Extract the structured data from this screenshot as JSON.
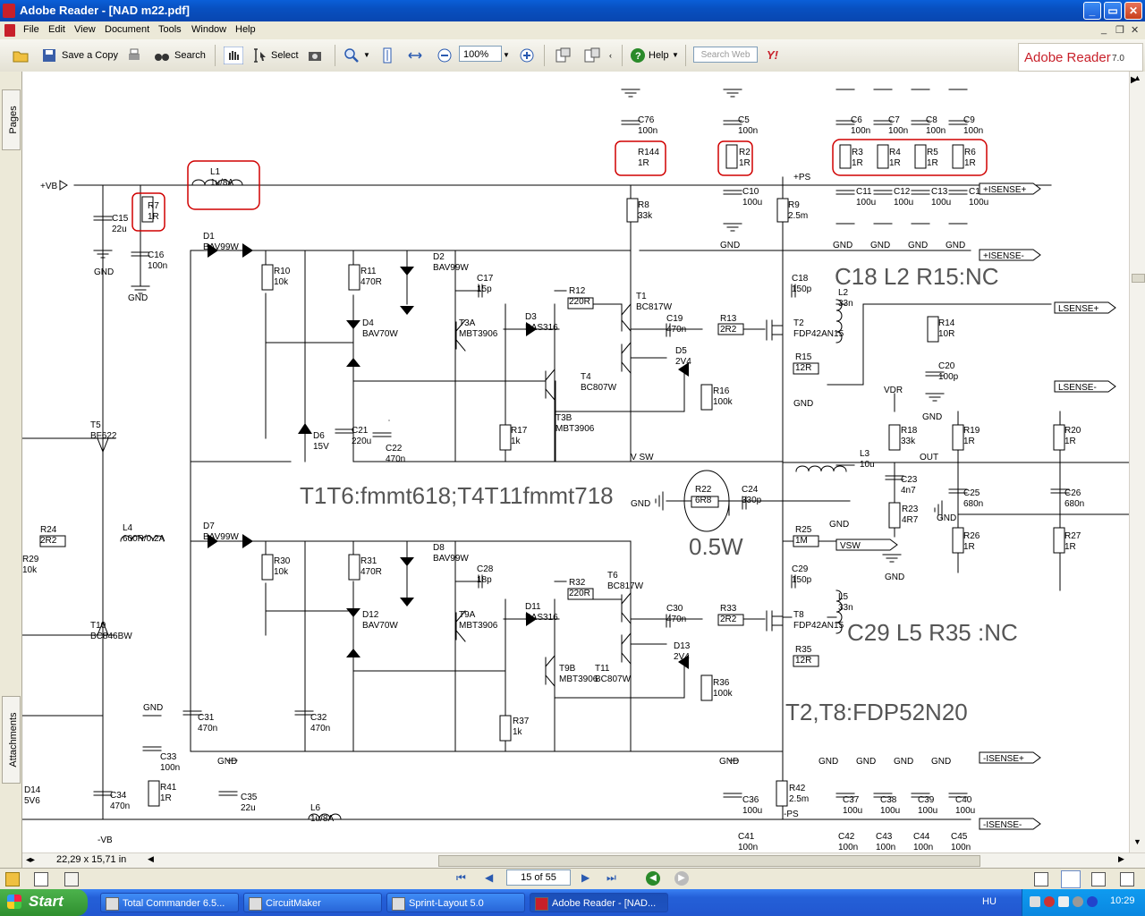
{
  "window": {
    "title": "Adobe Reader - [NAD m22.pdf]",
    "buttons": {
      "minimize": "_",
      "maximize": "▭",
      "close": "✕"
    }
  },
  "menu": [
    "File",
    "Edit",
    "View",
    "Document",
    "Tools",
    "Window",
    "Help"
  ],
  "toolbar": {
    "save_copy": "Save a Copy",
    "search": "Search",
    "select": "Select",
    "zoom": "100%",
    "help": "Help",
    "search_web_placeholder": "Search Web",
    "brand": "Adobe Reader",
    "version": "7.0"
  },
  "left_tabs": {
    "pages": "Pages",
    "attachments": "Attachments"
  },
  "status": {
    "page_size": "22,29 x 15,71 in",
    "page_box": "15 of 55"
  },
  "taskbar": {
    "start": "Start",
    "tasks": [
      "Total Commander 6.5...",
      "CircuitMaker",
      "Sprint-Layout 5.0",
      "Adobe Reader - [NAD..."
    ],
    "lang": "HU",
    "clock": "10:29"
  },
  "schematic": {
    "notes": [
      "C18 L2 R15:NC",
      "T1T6:fmmt618;T4T11fmmt718",
      "0.5W",
      "C29 L5 R35 :NC",
      "T2,T8:FDP52N20"
    ],
    "ports": [
      "+ISENSE+",
      "+ISENSE-",
      "LSENSE+",
      "LSENSE-",
      "VSW",
      "-ISENSE+",
      "-ISENSE-"
    ],
    "rails": [
      "+VB",
      "-VB",
      "+PS",
      "-PS",
      "VDR",
      "OUT",
      "V SW"
    ],
    "components": [
      {
        "ref": "L1",
        "val": "1u/8A"
      },
      {
        "ref": "R7",
        "val": "1R"
      },
      {
        "ref": "C15",
        "val": "22u"
      },
      {
        "ref": "C16",
        "val": "100n"
      },
      {
        "ref": "R144",
        "val": "1R"
      },
      {
        "ref": "C76",
        "val": "100n"
      },
      {
        "ref": "R2",
        "val": "1R"
      },
      {
        "ref": "C5",
        "val": "100n"
      },
      {
        "ref": "R3",
        "val": "1R"
      },
      {
        "ref": "R4",
        "val": "1R"
      },
      {
        "ref": "R5",
        "val": "1R"
      },
      {
        "ref": "R6",
        "val": "1R"
      },
      {
        "ref": "C6",
        "val": "100n"
      },
      {
        "ref": "C7",
        "val": "100n"
      },
      {
        "ref": "C8",
        "val": "100n"
      },
      {
        "ref": "C9",
        "val": "100n"
      },
      {
        "ref": "C10",
        "val": "100u"
      },
      {
        "ref": "C11",
        "val": "100u"
      },
      {
        "ref": "C12",
        "val": "100u"
      },
      {
        "ref": "C13",
        "val": "100u"
      },
      {
        "ref": "C14",
        "val": "100u"
      },
      {
        "ref": "R8",
        "val": "33k"
      },
      {
        "ref": "R9",
        "val": "2.5m"
      },
      {
        "ref": "D1",
        "val": "BAV99W"
      },
      {
        "ref": "D2",
        "val": "BAV99W"
      },
      {
        "ref": "R10",
        "val": "10k"
      },
      {
        "ref": "R11",
        "val": "470R"
      },
      {
        "ref": "C17",
        "val": "15p"
      },
      {
        "ref": "R12",
        "val": "220R"
      },
      {
        "ref": "T1",
        "val": "BC817W"
      },
      {
        "ref": "C18",
        "val": "150p"
      },
      {
        "ref": "L2",
        "val": "33n"
      },
      {
        "ref": "R14",
        "val": "10R"
      },
      {
        "ref": "D4",
        "val": "BAV70W"
      },
      {
        "ref": "T3A",
        "val": "MBT3906"
      },
      {
        "ref": "D3",
        "val": "BAS316"
      },
      {
        "ref": "C19",
        "val": "470n"
      },
      {
        "ref": "R13",
        "val": "2R2"
      },
      {
        "ref": "T2",
        "val": "FDP42AN15"
      },
      {
        "ref": "D5",
        "val": "2V4"
      },
      {
        "ref": "R15",
        "val": "12R"
      },
      {
        "ref": "C20",
        "val": "100p"
      },
      {
        "ref": "T4",
        "val": "BC807W"
      },
      {
        "ref": "R16",
        "val": "100k"
      },
      {
        "ref": "R18",
        "val": "33k"
      },
      {
        "ref": "R19",
        "val": "1R"
      },
      {
        "ref": "R20",
        "val": "1R"
      },
      {
        "ref": "D6",
        "val": "15V"
      },
      {
        "ref": "C21",
        "val": "220u"
      },
      {
        "ref": "C22",
        "val": "470n"
      },
      {
        "ref": "R17",
        "val": "1k"
      },
      {
        "ref": "T3B",
        "val": "MBT3906"
      },
      {
        "ref": "L3",
        "val": "10u"
      },
      {
        "ref": "T5",
        "val": "BF622"
      },
      {
        "ref": "C23",
        "val": "4n7"
      },
      {
        "ref": "R22",
        "val": "6R8"
      },
      {
        "ref": "C24",
        "val": "330p"
      },
      {
        "ref": "R23",
        "val": "4R7"
      },
      {
        "ref": "C25",
        "val": "680n"
      },
      {
        "ref": "C26",
        "val": "680n"
      },
      {
        "ref": "R24",
        "val": "2R2"
      },
      {
        "ref": "L4",
        "val": "600R/0.2A"
      },
      {
        "ref": "D7",
        "val": "BAV99W"
      },
      {
        "ref": "R30",
        "val": "10k"
      },
      {
        "ref": "R31",
        "val": "470R"
      },
      {
        "ref": "D8",
        "val": "BAV99W"
      },
      {
        "ref": "R25",
        "val": "1M"
      },
      {
        "ref": "R26",
        "val": "1R"
      },
      {
        "ref": "R27",
        "val": "1R"
      },
      {
        "ref": "R29",
        "val": "10k"
      },
      {
        "ref": "C28",
        "val": "18p"
      },
      {
        "ref": "R32",
        "val": "220R"
      },
      {
        "ref": "T6",
        "val": "BC817W"
      },
      {
        "ref": "C29",
        "val": "150p"
      },
      {
        "ref": "L5",
        "val": "33n"
      },
      {
        "ref": "D11",
        "val": "BAS316"
      },
      {
        "ref": "C30",
        "val": "470n"
      },
      {
        "ref": "R33",
        "val": "2R2"
      },
      {
        "ref": "T8",
        "val": "FDP42AN15"
      },
      {
        "ref": "T10",
        "val": "BC846BW"
      },
      {
        "ref": "D12",
        "val": "BAV70W"
      },
      {
        "ref": "T9A",
        "val": "MBT3906"
      },
      {
        "ref": "D13",
        "val": "2V4"
      },
      {
        "ref": "R35",
        "val": "12R"
      },
      {
        "ref": "T9B",
        "val": "MBT3906"
      },
      {
        "ref": "T11",
        "val": "BC807W"
      },
      {
        "ref": "R36",
        "val": "100k"
      },
      {
        "ref": "C31",
        "val": "470n"
      },
      {
        "ref": "C32",
        "val": "470n"
      },
      {
        "ref": "R37",
        "val": "1k"
      },
      {
        "ref": "C33",
        "val": "100n"
      },
      {
        "ref": "R41",
        "val": "1R"
      },
      {
        "ref": "C35",
        "val": "22u"
      },
      {
        "ref": "C34",
        "val": "470n"
      },
      {
        "ref": "D14",
        "val": "5V6"
      },
      {
        "ref": "L6",
        "val": "1u/8A"
      },
      {
        "ref": "C36",
        "val": "100u"
      },
      {
        "ref": "R42",
        "val": "2.5m"
      },
      {
        "ref": "C37",
        "val": "100u"
      },
      {
        "ref": "C38",
        "val": "100u"
      },
      {
        "ref": "C39",
        "val": "100u"
      },
      {
        "ref": "C40",
        "val": "100u"
      },
      {
        "ref": "C41",
        "val": "100n"
      },
      {
        "ref": "C42",
        "val": "100n"
      },
      {
        "ref": "C43",
        "val": "100n"
      },
      {
        "ref": "C44",
        "val": "100n"
      },
      {
        "ref": "C45",
        "val": "100n"
      }
    ],
    "gnd_label": "GND"
  }
}
